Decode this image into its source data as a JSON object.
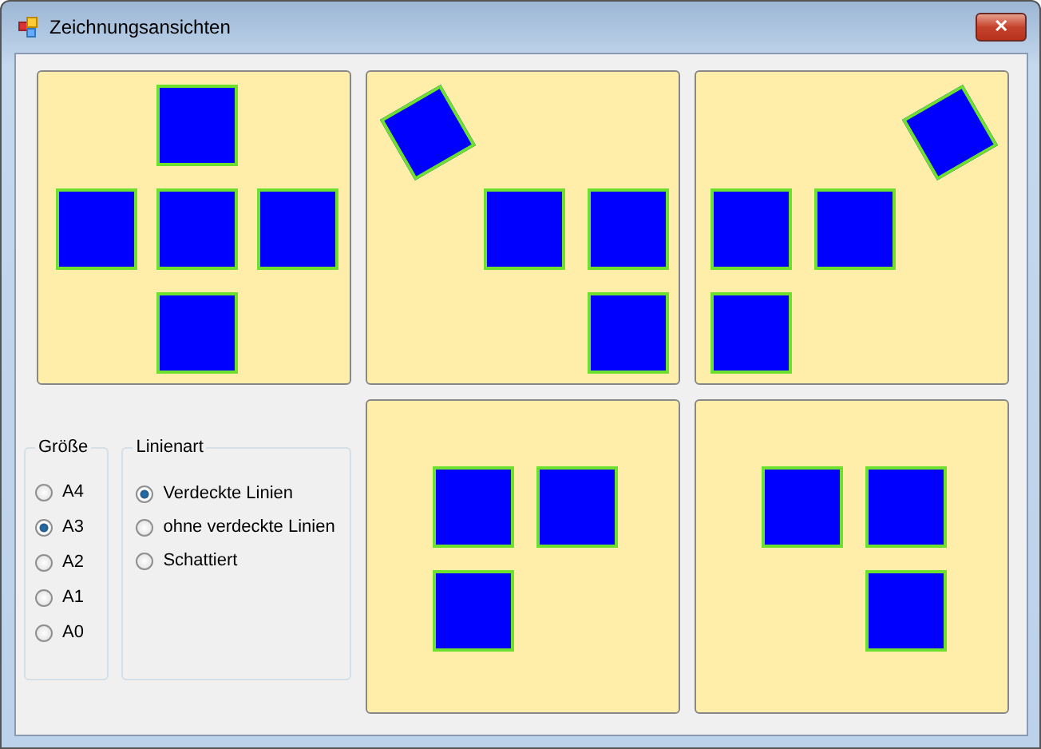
{
  "window": {
    "title": "Zeichnungsansichten",
    "close": "✕"
  },
  "views": [
    {
      "kind": "cross"
    },
    {
      "kind": "iso-left"
    },
    {
      "kind": "iso-right"
    },
    {
      "kind": "left-l"
    },
    {
      "kind": "right-l"
    }
  ],
  "size_group": {
    "title": "Größe",
    "options": [
      {
        "label": "A4",
        "selected": false
      },
      {
        "label": "A3",
        "selected": true
      },
      {
        "label": "A2",
        "selected": false
      },
      {
        "label": "A1",
        "selected": false
      },
      {
        "label": "A0",
        "selected": false
      }
    ]
  },
  "line_group": {
    "title": "Linienart",
    "options": [
      {
        "label": "Verdeckte Linien",
        "selected": true
      },
      {
        "label": "ohne verdeckte Linien",
        "selected": false
      },
      {
        "label": "Schattiert",
        "selected": false
      }
    ]
  }
}
